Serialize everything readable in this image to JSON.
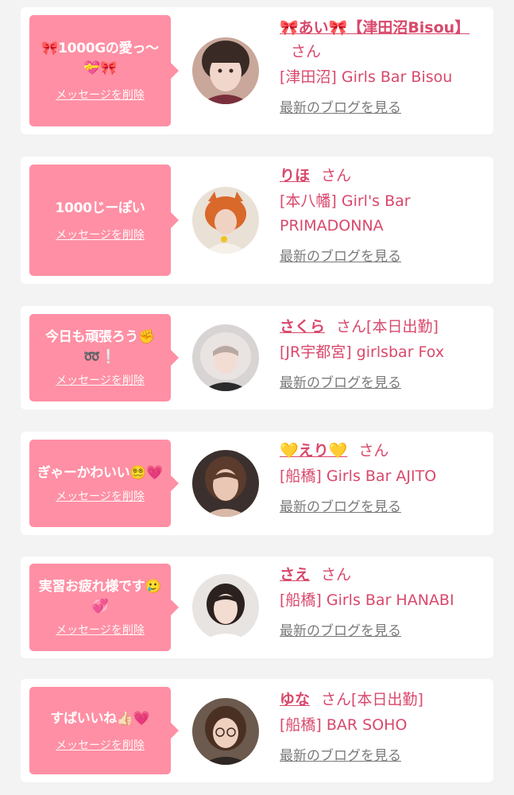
{
  "common": {
    "delete_label": "メッセージを削除",
    "blog_label": "最新のブログを見る",
    "san": "さん"
  },
  "cards": [
    {
      "message": "🎀1000Gの愛っ〜💝🎀",
      "name": "🎀あい🎀【津田沼Bisou】",
      "status": "",
      "shop": "[津田沼] Girls Bar Bisou",
      "avatar": {
        "bg": "#c9a79a",
        "skin": "#f1d6cc",
        "hair": "#3a2a25"
      }
    },
    {
      "message": "1000じーぽい",
      "name": "りほ",
      "status": "",
      "shop": "[本八幡] Girl's Bar PRIMADONNA",
      "avatar": {
        "bg": "#e9e1d6",
        "skin": "#f0d2c3",
        "hair": "#d9682b"
      }
    },
    {
      "message": "今日も頑張ろう✊️➿❕",
      "name": "さくら",
      "status": "[本日出勤]",
      "shop": "[JR宇都宮] girlsbar Fox",
      "avatar": {
        "bg": "#d8d4d3",
        "skin": "#f3dcd4",
        "hair": "#e9e4e2"
      }
    },
    {
      "message": "ぎゃーかわいい😵‍💫💗",
      "name": "💛えり💛",
      "status": "",
      "shop": "[船橋] Girls Bar AJITO",
      "avatar": {
        "bg": "#3b302d",
        "skin": "#eac7b4",
        "hair": "#5a3b2c"
      }
    },
    {
      "message": "実習お疲れ様です🥲💞",
      "name": "さえ",
      "status": "",
      "shop": "[船橋] Girls Bar HANABI",
      "avatar": {
        "bg": "#e7e4e2",
        "skin": "#f3dcd2",
        "hair": "#2b211e"
      }
    },
    {
      "message": "すばいいね👍🏻💗",
      "name": "ゆな",
      "status": "[本日出勤]",
      "shop": "[船橋] BAR SOHO",
      "avatar": {
        "bg": "#6b5a4d",
        "skin": "#efcfbd",
        "hair": "#4a3022"
      }
    }
  ]
}
